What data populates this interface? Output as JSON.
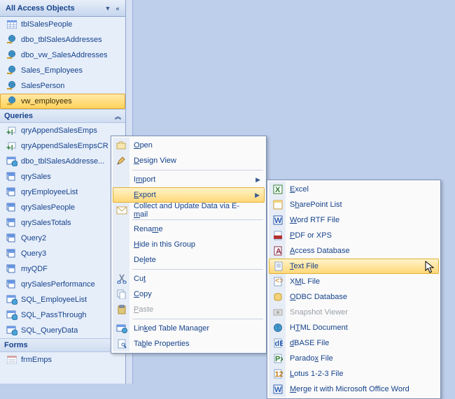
{
  "nav": {
    "title": "All Access Objects",
    "sections": [
      {
        "name": "tables",
        "items": [
          {
            "label": "tblSalesPeople",
            "icon": "table",
            "selected": false
          },
          {
            "label": "dbo_tblSalesAddresses",
            "icon": "linked-view",
            "selected": false
          },
          {
            "label": "dbo_vw_SalesAddresses",
            "icon": "linked-view",
            "selected": false
          },
          {
            "label": "Sales_Employees",
            "icon": "linked-view",
            "selected": false
          },
          {
            "label": "SalesPerson",
            "icon": "linked-view",
            "selected": false
          },
          {
            "label": "vw_employees",
            "icon": "linked-view",
            "selected": true
          }
        ]
      },
      {
        "name": "queries",
        "title": "Queries",
        "items": [
          {
            "label": "qryAppendSalesEmps",
            "icon": "append-query"
          },
          {
            "label": "qryAppendSalesEmpsCR",
            "icon": "append-query"
          },
          {
            "label": "dbo_tblSalesAddresse...",
            "icon": "pt-query"
          },
          {
            "label": "qrySales",
            "icon": "select-query"
          },
          {
            "label": "qryEmployeeList",
            "icon": "select-query"
          },
          {
            "label": "qrySalesPeople",
            "icon": "select-query"
          },
          {
            "label": "qrySalesTotals",
            "icon": "select-query"
          },
          {
            "label": "Query2",
            "icon": "select-query"
          },
          {
            "label": "Query3",
            "icon": "select-query"
          },
          {
            "label": "myQDF",
            "icon": "select-query"
          },
          {
            "label": "qrySalesPerformance",
            "icon": "select-query"
          },
          {
            "label": "SQL_EmployeeList",
            "icon": "pt-query"
          },
          {
            "label": "SQL_PassThrough",
            "icon": "pt-query"
          },
          {
            "label": "SQL_QueryData",
            "icon": "pt-query"
          }
        ]
      },
      {
        "name": "forms",
        "title": "Forms",
        "items": [
          {
            "label": "frmEmps",
            "icon": "form"
          }
        ]
      }
    ]
  },
  "context_menu": {
    "items": [
      {
        "label": "<u>O</u>pen",
        "icon": "open-icon"
      },
      {
        "label": "<u>D</u>esign View",
        "icon": "design-icon"
      },
      {
        "sep": true
      },
      {
        "label": "I<u>m</u>port",
        "submenu": true
      },
      {
        "label": "<u>E</u>xport",
        "submenu": true,
        "highlight": true
      },
      {
        "label": "Collect and Update Data via E-<u>m</u>ail",
        "icon": "mail-icon"
      },
      {
        "sep": true
      },
      {
        "label": "Rena<u>m</u>e"
      },
      {
        "label": "<u>H</u>ide in this Group"
      },
      {
        "label": "De<u>l</u>ete"
      },
      {
        "sep": true
      },
      {
        "label": "Cu<u>t</u>",
        "icon": "cut-icon"
      },
      {
        "label": "<u>C</u>opy",
        "icon": "copy-icon"
      },
      {
        "label": "<u>P</u>aste",
        "icon": "paste-icon",
        "disabled": true
      },
      {
        "sep": true
      },
      {
        "label": "Lin<u>k</u>ed Table Manager",
        "icon": "linked-mgr-icon"
      },
      {
        "label": "Ta<u>b</u>le Properties",
        "icon": "props-icon"
      }
    ]
  },
  "export_submenu": {
    "items": [
      {
        "label": "<u>E</u>xcel",
        "icon": "excel-icon"
      },
      {
        "label": "S<u>h</u>arePoint List",
        "icon": "sharepoint-icon"
      },
      {
        "label": "<u>W</u>ord RTF File",
        "icon": "word-icon"
      },
      {
        "label": "<u>P</u>DF or XPS",
        "icon": "pdf-icon"
      },
      {
        "label": "<u>A</u>ccess Database",
        "icon": "access-icon"
      },
      {
        "label": "<u>T</u>ext File",
        "icon": "text-icon",
        "highlight": true
      },
      {
        "label": "X<u>M</u>L File",
        "icon": "xml-icon"
      },
      {
        "label": "<u>O</u>DBC Database",
        "icon": "odbc-icon"
      },
      {
        "label": "Snapshot Viewer",
        "icon": "snapshot-icon",
        "disabled": true
      },
      {
        "label": "H<u>T</u>ML Document",
        "icon": "html-icon"
      },
      {
        "label": "<u>d</u>BASE File",
        "icon": "dbase-icon"
      },
      {
        "label": "Parado<u>x</u> File",
        "icon": "paradox-icon"
      },
      {
        "label": "<u>L</u>otus 1-2-3 File",
        "icon": "lotus-icon"
      },
      {
        "label": "<u>M</u>erge it with Microsoft Office Word",
        "icon": "merge-icon"
      }
    ]
  }
}
